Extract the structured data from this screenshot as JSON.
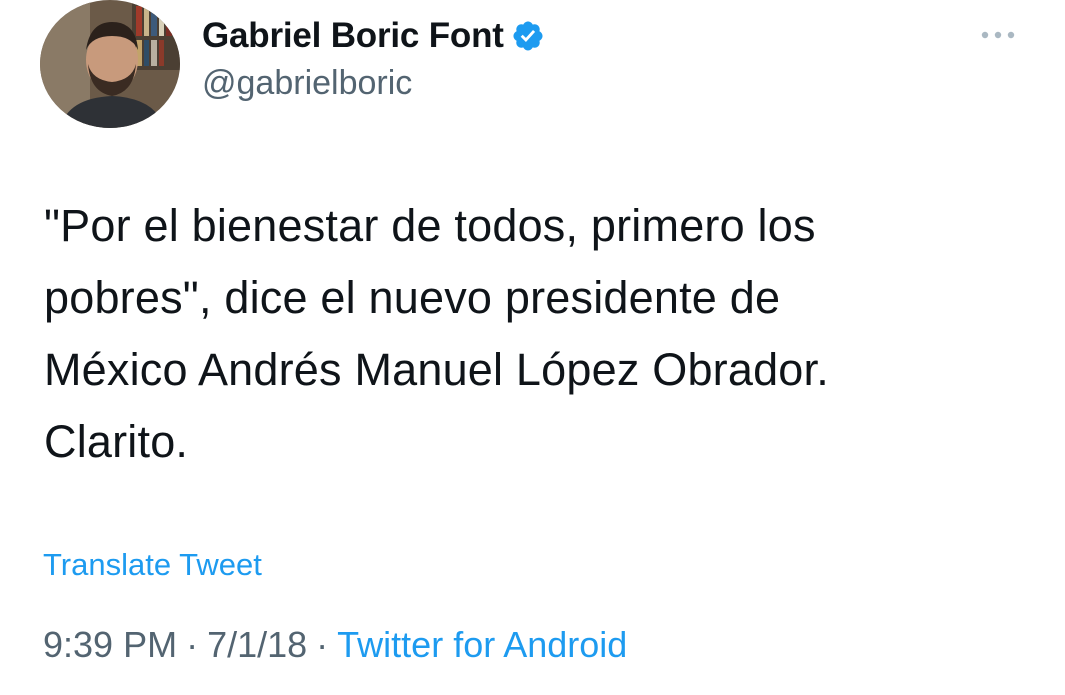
{
  "author": {
    "display_name": "Gabriel Boric Font",
    "handle": "@gabrielboric",
    "verified": true,
    "verified_color": "#1d9bf0"
  },
  "tweet": {
    "text": "\"Por el bienestar de todos, primero los\npobres\", dice el nuevo presidente de\nMéxico Andrés Manuel López Obrador.\nClarito.",
    "translate_label": "Translate Tweet",
    "time": "9:39 PM",
    "date": "7/1/18",
    "separator": "·",
    "source": "Twitter for Android"
  },
  "icons": {
    "avatar": "profile-photo",
    "verified": "verified-badge-icon",
    "more": "more-options-icon"
  },
  "colors": {
    "text_primary": "#0f1419",
    "text_secondary": "#536471",
    "link": "#1d9bf0"
  }
}
